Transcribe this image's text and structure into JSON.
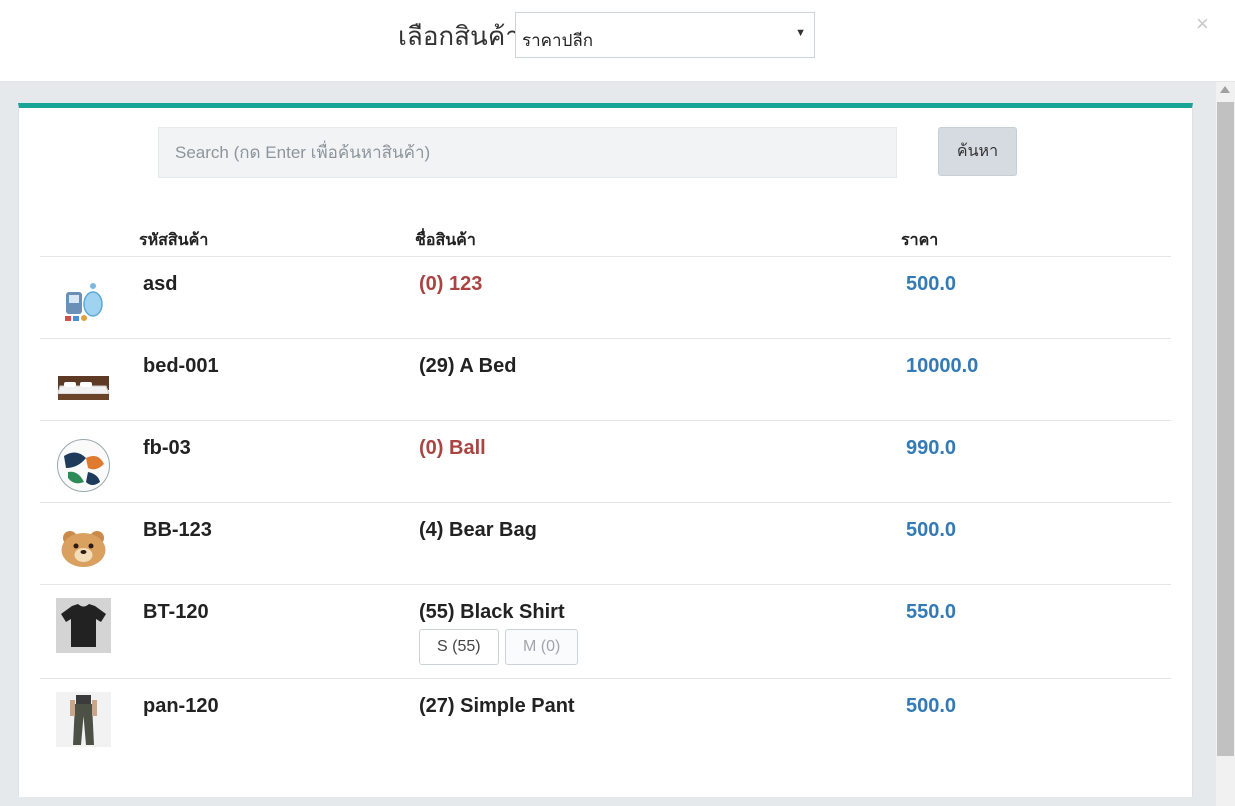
{
  "header": {
    "label": "เลือกสินค้า",
    "price_type": "ราคาปลีก",
    "close": "×"
  },
  "search": {
    "placeholder": "Search (กด Enter เพื่อค้นหาสินค้า)",
    "button": "ค้นหา"
  },
  "table": {
    "headers": {
      "code": "รหัสสินค้า",
      "name": "ชื่อสินค้า",
      "price": "ราคา"
    },
    "rows": [
      {
        "code": "asd",
        "name": "(0) 123",
        "price": "500.0",
        "image": "appliance-icon",
        "in_stock": false,
        "variants": []
      },
      {
        "code": "bed-001",
        "name": "(29) A Bed",
        "price": "10000.0",
        "image": "bed-image",
        "in_stock": true,
        "variants": []
      },
      {
        "code": "fb-03",
        "name": "(0) Ball",
        "price": "990.0",
        "image": "football-image",
        "in_stock": false,
        "variants": []
      },
      {
        "code": "BB-123",
        "name": "(4) Bear Bag",
        "price": "500.0",
        "image": "bear-bag-image",
        "in_stock": true,
        "variants": []
      },
      {
        "code": "BT-120",
        "name": "(55) Black Shirt",
        "price": "550.0",
        "image": "black-shirt-image",
        "in_stock": true,
        "variants": [
          {
            "label": "S (55)",
            "available": true
          },
          {
            "label": "M (0)",
            "available": false
          }
        ]
      },
      {
        "code": "pan-120",
        "name": "(27) Simple Pant",
        "price": "500.0",
        "image": "pant-image",
        "in_stock": true,
        "variants": []
      }
    ]
  },
  "colors": {
    "accent": "#17a598",
    "price": "#337ab7",
    "out_of_stock": "#a94442"
  }
}
